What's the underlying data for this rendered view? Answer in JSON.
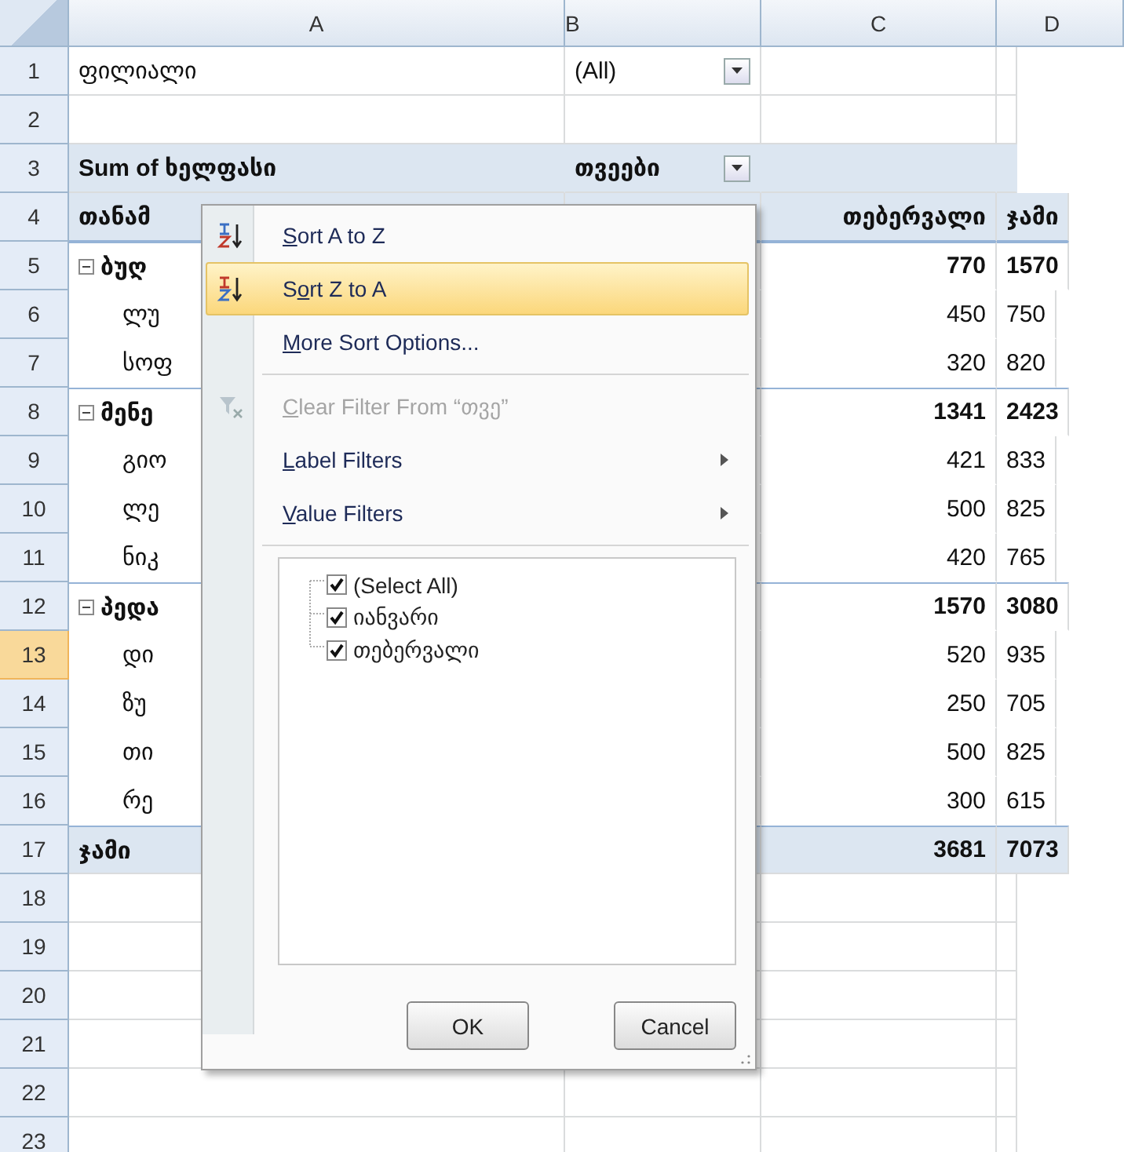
{
  "columns": [
    "A",
    "B",
    "C",
    "D"
  ],
  "rows": [
    {
      "number": "1",
      "selected": false,
      "kind": "filter",
      "a": "ფილიალი",
      "b": "(All)"
    },
    {
      "number": "2",
      "selected": false,
      "kind": "empty"
    },
    {
      "number": "3",
      "selected": false,
      "kind": "title",
      "a": "Sum of ხელფასი",
      "b": "თვეები"
    },
    {
      "number": "4",
      "selected": false,
      "kind": "header",
      "a": "თანამ",
      "c": "თებერვალი",
      "d": "ჯამი"
    },
    {
      "number": "5",
      "selected": false,
      "kind": "group",
      "a": "ბუღ",
      "c": "770",
      "d": "1570"
    },
    {
      "number": "6",
      "selected": false,
      "kind": "item",
      "a": "ლუ",
      "c": "450",
      "d": "750"
    },
    {
      "number": "7",
      "selected": false,
      "kind": "item",
      "a": "სოფ",
      "c": "320",
      "d": "820"
    },
    {
      "number": "8",
      "selected": false,
      "kind": "group",
      "a": "მენე",
      "c": "1341",
      "d": "2423"
    },
    {
      "number": "9",
      "selected": false,
      "kind": "item",
      "a": "გიო",
      "c": "421",
      "d": "833"
    },
    {
      "number": "10",
      "selected": false,
      "kind": "item",
      "a": "ლე",
      "c": "500",
      "d": "825"
    },
    {
      "number": "11",
      "selected": false,
      "kind": "item",
      "a": "ნიკ",
      "c": "420",
      "d": "765"
    },
    {
      "number": "12",
      "selected": false,
      "kind": "group",
      "a": "პედა",
      "c": "1570",
      "d": "3080"
    },
    {
      "number": "13",
      "selected": true,
      "kind": "item",
      "a": "დი",
      "c": "520",
      "d": "935"
    },
    {
      "number": "14",
      "selected": false,
      "kind": "item",
      "a": "ზუ",
      "c": "250",
      "d": "705"
    },
    {
      "number": "15",
      "selected": false,
      "kind": "item",
      "a": "თი",
      "c": "500",
      "d": "825"
    },
    {
      "number": "16",
      "selected": false,
      "kind": "item",
      "a": "რე",
      "c": "300",
      "d": "615"
    },
    {
      "number": "17",
      "selected": false,
      "kind": "total",
      "a": "ჯამი",
      "c": "3681",
      "d": "7073"
    },
    {
      "number": "18",
      "selected": false,
      "kind": "empty"
    },
    {
      "number": "19",
      "selected": false,
      "kind": "empty"
    },
    {
      "number": "20",
      "selected": false,
      "kind": "empty"
    },
    {
      "number": "21",
      "selected": false,
      "kind": "empty"
    },
    {
      "number": "22",
      "selected": false,
      "kind": "empty"
    },
    {
      "number": "23",
      "selected": false,
      "kind": "empty"
    }
  ],
  "menu": {
    "items": [
      {
        "kind": "sort-asc",
        "selected": false,
        "disabled": false,
        "mnemonic": "S",
        "rest": "ort A to Z"
      },
      {
        "kind": "sort-desc",
        "selected": true,
        "disabled": false,
        "before": "S",
        "mnemonic": "o",
        "rest": "rt Z to A"
      },
      {
        "kind": "plain",
        "selected": false,
        "disabled": false,
        "mnemonic": "M",
        "rest": "ore Sort Options..."
      },
      {
        "kind": "separator"
      },
      {
        "kind": "clear",
        "selected": false,
        "disabled": true,
        "mnemonic": "C",
        "rest": "lear Filter From “თვე”"
      },
      {
        "kind": "submenu",
        "selected": false,
        "disabled": false,
        "mnemonic": "L",
        "rest": "abel Filters"
      },
      {
        "kind": "submenu",
        "selected": false,
        "disabled": false,
        "mnemonic": "V",
        "rest": "alue Filters"
      },
      {
        "kind": "separator"
      }
    ],
    "checklist": [
      {
        "label": "(Select All)",
        "checked": true
      },
      {
        "label": "იანვარი",
        "checked": true
      },
      {
        "label": "თებერვალი",
        "checked": true
      }
    ],
    "buttons": [
      "OK",
      "Cancel"
    ]
  }
}
